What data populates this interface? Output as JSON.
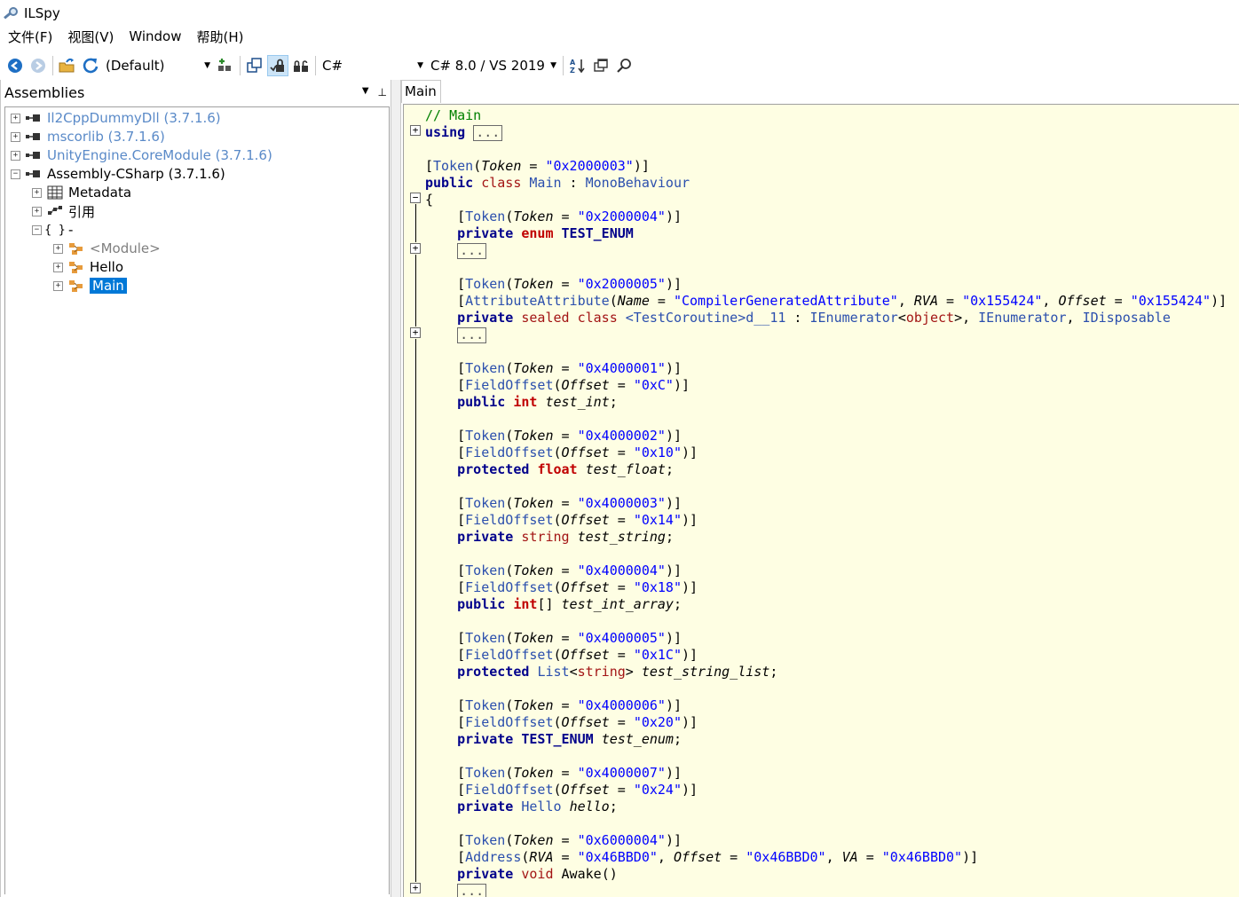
{
  "window": {
    "title": "ILSpy"
  },
  "menu": [
    "文件(F)",
    "视图(V)",
    "Window",
    "帮助(H)"
  ],
  "toolbar": {
    "assembly_list_combo": "(Default)",
    "language_combo": "C#",
    "language_version_combo": "C# 8.0 / VS 2019"
  },
  "assemblies_pane": {
    "header": "Assemblies",
    "tree": [
      {
        "label": "Il2CppDummyDll (3.7.1.6)",
        "expander": "+",
        "style": "gray"
      },
      {
        "label": "mscorlib (3.7.1.6)",
        "expander": "+",
        "style": "gray"
      },
      {
        "label": "UnityEngine.CoreModule (3.7.1.6)",
        "expander": "+",
        "style": "gray"
      },
      {
        "label": "Assembly-CSharp (3.7.1.6)",
        "expander": "-",
        "style": "normal"
      },
      {
        "label": "Metadata",
        "expander": "+",
        "style": "normal"
      },
      {
        "label": "引用",
        "expander": "+",
        "style": "normal"
      },
      {
        "label": "-",
        "expander": "-",
        "style": "normal",
        "icon_text": "{ }"
      },
      {
        "label": "<Module>",
        "expander": "+",
        "style": "module"
      },
      {
        "label": "Hello",
        "expander": "+",
        "style": "normal"
      },
      {
        "label": "Main",
        "expander": "+",
        "style": "selected"
      }
    ]
  },
  "editor": {
    "tab_label": "Main",
    "ellipsis": "...",
    "code_lines": [
      [
        [
          "c-comment",
          "// Main"
        ]
      ],
      [
        [
          "c-kw",
          "using"
        ],
        [
          "",
          " "
        ],
        [
          "box",
          "..."
        ]
      ],
      [
        [
          "",
          ""
        ]
      ],
      [
        [
          "",
          "["
        ],
        [
          "c-attr",
          "Token"
        ],
        [
          "",
          "("
        ],
        [
          "c-param",
          "Token"
        ],
        [
          "",
          " = "
        ],
        [
          "c-str",
          "\"0x2000003\""
        ],
        [
          "",
          ")]"
        ]
      ],
      [
        [
          "c-kw",
          "public"
        ],
        [
          "",
          " "
        ],
        [
          "c-kwr",
          "class"
        ],
        [
          "",
          " "
        ],
        [
          "c-type",
          "Main"
        ],
        [
          "",
          " : "
        ],
        [
          "c-type",
          "MonoBehaviour"
        ]
      ],
      [
        [
          "",
          "{"
        ]
      ],
      [
        [
          "",
          "    ["
        ],
        [
          "c-attr",
          "Token"
        ],
        [
          "",
          "("
        ],
        [
          "c-param",
          "Token"
        ],
        [
          "",
          " = "
        ],
        [
          "c-str",
          "\"0x2000004\""
        ],
        [
          "",
          ")]"
        ]
      ],
      [
        [
          "",
          "    "
        ],
        [
          "c-kw",
          "private"
        ],
        [
          "",
          " "
        ],
        [
          "c-red",
          "enum"
        ],
        [
          "",
          " "
        ],
        [
          "c-enum",
          "TEST_ENUM"
        ]
      ],
      [
        [
          "",
          "    "
        ],
        [
          "box",
          "..."
        ]
      ],
      [
        [
          "",
          ""
        ]
      ],
      [
        [
          "",
          "    ["
        ],
        [
          "c-attr",
          "Token"
        ],
        [
          "",
          "("
        ],
        [
          "c-param",
          "Token"
        ],
        [
          "",
          " = "
        ],
        [
          "c-str",
          "\"0x2000005\""
        ],
        [
          "",
          ")]"
        ]
      ],
      [
        [
          "",
          "    ["
        ],
        [
          "c-attr",
          "AttributeAttribute"
        ],
        [
          "",
          "("
        ],
        [
          "c-param",
          "Name"
        ],
        [
          "",
          " = "
        ],
        [
          "c-str",
          "\"CompilerGeneratedAttribute\""
        ],
        [
          "",
          ", "
        ],
        [
          "c-param",
          "RVA"
        ],
        [
          "",
          " = "
        ],
        [
          "c-str",
          "\"0x155424\""
        ],
        [
          "",
          ", "
        ],
        [
          "c-param",
          "Offset"
        ],
        [
          "",
          " = "
        ],
        [
          "c-str",
          "\"0x155424\""
        ],
        [
          "",
          ")]"
        ]
      ],
      [
        [
          "",
          "    "
        ],
        [
          "c-kw",
          "private"
        ],
        [
          "",
          " "
        ],
        [
          "c-kwr",
          "sealed"
        ],
        [
          "",
          " "
        ],
        [
          "c-kwr",
          "class"
        ],
        [
          "",
          " "
        ],
        [
          "c-type",
          "<TestCoroutine>d__11"
        ],
        [
          "",
          " : "
        ],
        [
          "c-type",
          "IEnumerator"
        ],
        [
          "",
          "<"
        ],
        [
          "c-kwr",
          "object"
        ],
        [
          "",
          ">, "
        ],
        [
          "c-type",
          "IEnumerator"
        ],
        [
          "",
          ", "
        ],
        [
          "c-type",
          "IDisposable"
        ]
      ],
      [
        [
          "",
          "    "
        ],
        [
          "box",
          "..."
        ]
      ],
      [
        [
          "",
          ""
        ]
      ],
      [
        [
          "",
          "    ["
        ],
        [
          "c-attr",
          "Token"
        ],
        [
          "",
          "("
        ],
        [
          "c-param",
          "Token"
        ],
        [
          "",
          " = "
        ],
        [
          "c-str",
          "\"0x4000001\""
        ],
        [
          "",
          ")]"
        ]
      ],
      [
        [
          "",
          "    ["
        ],
        [
          "c-attr",
          "FieldOffset"
        ],
        [
          "",
          "("
        ],
        [
          "c-param",
          "Offset"
        ],
        [
          "",
          " = "
        ],
        [
          "c-str",
          "\"0xC\""
        ],
        [
          "",
          ")]"
        ]
      ],
      [
        [
          "",
          "    "
        ],
        [
          "c-kw",
          "public"
        ],
        [
          "",
          " "
        ],
        [
          "c-red",
          "int"
        ],
        [
          "",
          " "
        ],
        [
          "c-param",
          "test_int"
        ],
        [
          "",
          ";"
        ]
      ],
      [
        [
          "",
          ""
        ]
      ],
      [
        [
          "",
          "    ["
        ],
        [
          "c-attr",
          "Token"
        ],
        [
          "",
          "("
        ],
        [
          "c-param",
          "Token"
        ],
        [
          "",
          " = "
        ],
        [
          "c-str",
          "\"0x4000002\""
        ],
        [
          "",
          ")]"
        ]
      ],
      [
        [
          "",
          "    ["
        ],
        [
          "c-attr",
          "FieldOffset"
        ],
        [
          "",
          "("
        ],
        [
          "c-param",
          "Offset"
        ],
        [
          "",
          " = "
        ],
        [
          "c-str",
          "\"0x10\""
        ],
        [
          "",
          ")]"
        ]
      ],
      [
        [
          "",
          "    "
        ],
        [
          "c-kw",
          "protected"
        ],
        [
          "",
          " "
        ],
        [
          "c-red",
          "float"
        ],
        [
          "",
          " "
        ],
        [
          "c-param",
          "test_float"
        ],
        [
          "",
          ";"
        ]
      ],
      [
        [
          "",
          ""
        ]
      ],
      [
        [
          "",
          "    ["
        ],
        [
          "c-attr",
          "Token"
        ],
        [
          "",
          "("
        ],
        [
          "c-param",
          "Token"
        ],
        [
          "",
          " = "
        ],
        [
          "c-str",
          "\"0x4000003\""
        ],
        [
          "",
          ")]"
        ]
      ],
      [
        [
          "",
          "    ["
        ],
        [
          "c-attr",
          "FieldOffset"
        ],
        [
          "",
          "("
        ],
        [
          "c-param",
          "Offset"
        ],
        [
          "",
          " = "
        ],
        [
          "c-str",
          "\"0x14\""
        ],
        [
          "",
          ")]"
        ]
      ],
      [
        [
          "",
          "    "
        ],
        [
          "c-kw",
          "private"
        ],
        [
          "",
          " "
        ],
        [
          "c-kwr",
          "string"
        ],
        [
          "",
          " "
        ],
        [
          "c-param",
          "test_string"
        ],
        [
          "",
          ";"
        ]
      ],
      [
        [
          "",
          ""
        ]
      ],
      [
        [
          "",
          "    ["
        ],
        [
          "c-attr",
          "Token"
        ],
        [
          "",
          "("
        ],
        [
          "c-param",
          "Token"
        ],
        [
          "",
          " = "
        ],
        [
          "c-str",
          "\"0x4000004\""
        ],
        [
          "",
          ")]"
        ]
      ],
      [
        [
          "",
          "    ["
        ],
        [
          "c-attr",
          "FieldOffset"
        ],
        [
          "",
          "("
        ],
        [
          "c-param",
          "Offset"
        ],
        [
          "",
          " = "
        ],
        [
          "c-str",
          "\"0x18\""
        ],
        [
          "",
          ")]"
        ]
      ],
      [
        [
          "",
          "    "
        ],
        [
          "c-kw",
          "public"
        ],
        [
          "",
          " "
        ],
        [
          "c-red",
          "int"
        ],
        [
          "",
          "[] "
        ],
        [
          "c-param",
          "test_int_array"
        ],
        [
          "",
          ";"
        ]
      ],
      [
        [
          "",
          ""
        ]
      ],
      [
        [
          "",
          "    ["
        ],
        [
          "c-attr",
          "Token"
        ],
        [
          "",
          "("
        ],
        [
          "c-param",
          "Token"
        ],
        [
          "",
          " = "
        ],
        [
          "c-str",
          "\"0x4000005\""
        ],
        [
          "",
          ")]"
        ]
      ],
      [
        [
          "",
          "    ["
        ],
        [
          "c-attr",
          "FieldOffset"
        ],
        [
          "",
          "("
        ],
        [
          "c-param",
          "Offset"
        ],
        [
          "",
          " = "
        ],
        [
          "c-str",
          "\"0x1C\""
        ],
        [
          "",
          ")]"
        ]
      ],
      [
        [
          "",
          "    "
        ],
        [
          "c-kw",
          "protected"
        ],
        [
          "",
          " "
        ],
        [
          "c-type",
          "List"
        ],
        [
          "",
          "<"
        ],
        [
          "c-kwr",
          "string"
        ],
        [
          "",
          "> "
        ],
        [
          "c-param",
          "test_string_list"
        ],
        [
          "",
          ";"
        ]
      ],
      [
        [
          "",
          ""
        ]
      ],
      [
        [
          "",
          "    ["
        ],
        [
          "c-attr",
          "Token"
        ],
        [
          "",
          "("
        ],
        [
          "c-param",
          "Token"
        ],
        [
          "",
          " = "
        ],
        [
          "c-str",
          "\"0x4000006\""
        ],
        [
          "",
          ")]"
        ]
      ],
      [
        [
          "",
          "    ["
        ],
        [
          "c-attr",
          "FieldOffset"
        ],
        [
          "",
          "("
        ],
        [
          "c-param",
          "Offset"
        ],
        [
          "",
          " = "
        ],
        [
          "c-str",
          "\"0x20\""
        ],
        [
          "",
          ")]"
        ]
      ],
      [
        [
          "",
          "    "
        ],
        [
          "c-kw",
          "private"
        ],
        [
          "",
          " "
        ],
        [
          "c-enum",
          "TEST_ENUM"
        ],
        [
          "",
          " "
        ],
        [
          "c-param",
          "test_enum"
        ],
        [
          "",
          ";"
        ]
      ],
      [
        [
          "",
          ""
        ]
      ],
      [
        [
          "",
          "    ["
        ],
        [
          "c-attr",
          "Token"
        ],
        [
          "",
          "("
        ],
        [
          "c-param",
          "Token"
        ],
        [
          "",
          " = "
        ],
        [
          "c-str",
          "\"0x4000007\""
        ],
        [
          "",
          ")]"
        ]
      ],
      [
        [
          "",
          "    ["
        ],
        [
          "c-attr",
          "FieldOffset"
        ],
        [
          "",
          "("
        ],
        [
          "c-param",
          "Offset"
        ],
        [
          "",
          " = "
        ],
        [
          "c-str",
          "\"0x24\""
        ],
        [
          "",
          ")]"
        ]
      ],
      [
        [
          "",
          "    "
        ],
        [
          "c-kw",
          "private"
        ],
        [
          "",
          " "
        ],
        [
          "c-type",
          "Hello"
        ],
        [
          "",
          " "
        ],
        [
          "c-param",
          "hello"
        ],
        [
          "",
          ";"
        ]
      ],
      [
        [
          "",
          ""
        ]
      ],
      [
        [
          "",
          "    ["
        ],
        [
          "c-attr",
          "Token"
        ],
        [
          "",
          "("
        ],
        [
          "c-param",
          "Token"
        ],
        [
          "",
          " = "
        ],
        [
          "c-str",
          "\"0x6000004\""
        ],
        [
          "",
          ")]"
        ]
      ],
      [
        [
          "",
          "    ["
        ],
        [
          "c-attr",
          "Address"
        ],
        [
          "",
          "("
        ],
        [
          "c-param",
          "RVA"
        ],
        [
          "",
          " = "
        ],
        [
          "c-str",
          "\"0x46BBD0\""
        ],
        [
          "",
          ", "
        ],
        [
          "c-param",
          "Offset"
        ],
        [
          "",
          " = "
        ],
        [
          "c-str",
          "\"0x46BBD0\""
        ],
        [
          "",
          ", "
        ],
        [
          "c-param",
          "VA"
        ],
        [
          "",
          " = "
        ],
        [
          "c-str",
          "\"0x46BBD0\""
        ],
        [
          "",
          ")]"
        ]
      ],
      [
        [
          "",
          "    "
        ],
        [
          "c-kw",
          "private"
        ],
        [
          "",
          " "
        ],
        [
          "c-kwr",
          "void"
        ],
        [
          "",
          " "
        ],
        [
          "",
          "Awake"
        ],
        [
          "",
          "()"
        ]
      ],
      [
        [
          "",
          "    "
        ],
        [
          "box",
          "..."
        ]
      ]
    ]
  }
}
